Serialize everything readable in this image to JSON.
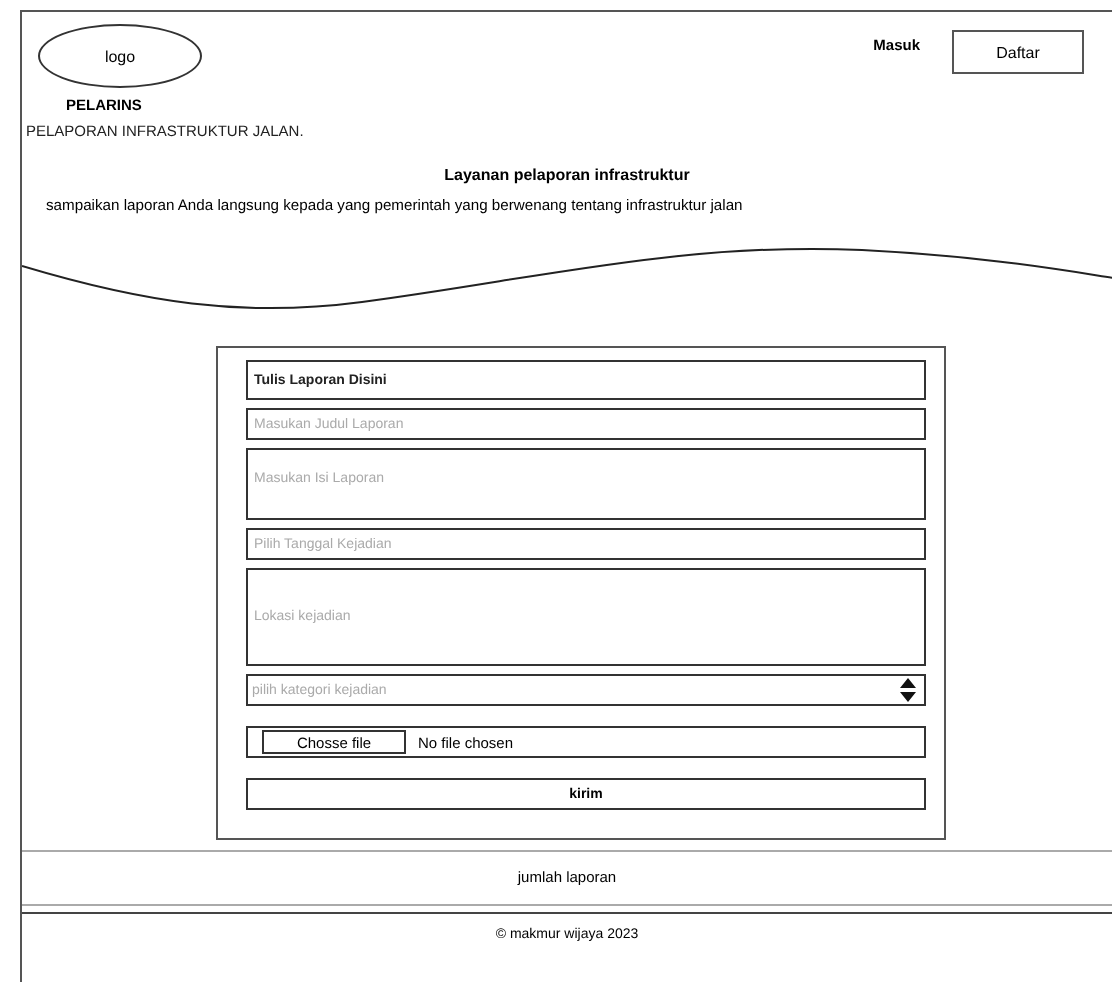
{
  "header": {
    "logo": "logo",
    "brand": "PELARINS",
    "login": "Masuk",
    "register": "Daftar"
  },
  "tagline": "PELAPORAN INFRASTRUKTUR JALAN.",
  "hero": {
    "title": "Layanan pelaporan infrastruktur",
    "subtitle": "sampaikan laporan Anda langsung kepada yang pemerintah yang berwenang tentang infrastruktur jalan"
  },
  "form": [
    {
      "kind": "heading",
      "text": "Tulis Laporan Disini"
    },
    {
      "kind": "input",
      "placeholder": "Masukan Judul Laporan"
    },
    {
      "kind": "textarea",
      "placeholder": "Masukan Isi Laporan"
    },
    {
      "kind": "input",
      "placeholder": "Pilih Tanggal Kejadian"
    },
    {
      "kind": "textarea_tall",
      "placeholder": "Lokasi kejadian"
    },
    {
      "kind": "select",
      "placeholder": "pilih kategori kejadian"
    },
    {
      "kind": "file",
      "button": "Chosse file",
      "status": "No file chosen"
    },
    {
      "kind": "submit",
      "text": "kirim"
    }
  ],
  "stats": "jumlah laporan",
  "footer": "© makmur  wijaya 2023"
}
